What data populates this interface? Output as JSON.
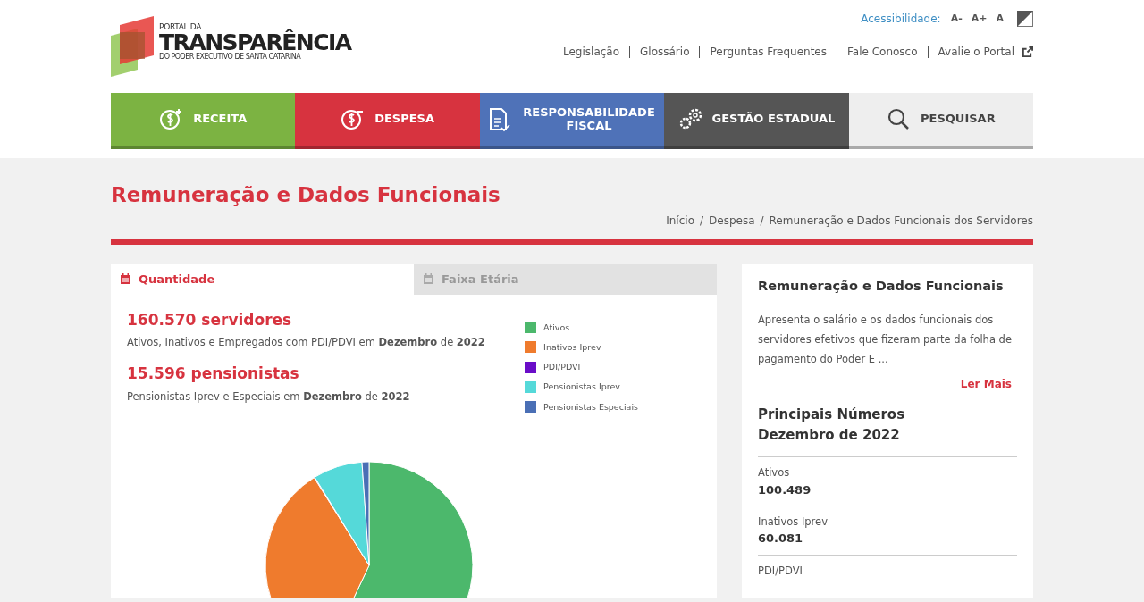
{
  "logo": {
    "line_1": "PORTAL DA",
    "line_2": "TRANSPARÊNCIA",
    "line_3": "DO PODER EXECUTIVO DE SANTA CATARINA"
  },
  "accessibility": {
    "label": "Acessibilidade:",
    "options": [
      "A-",
      "A+",
      "A"
    ]
  },
  "top_links": [
    {
      "label": "Legislação",
      "external": false
    },
    {
      "label": "Glossário",
      "external": false
    },
    {
      "label": "Perguntas Frequentes",
      "external": false
    },
    {
      "label": "Fale Conosco",
      "external": false
    },
    {
      "label": "Avalie o Portal",
      "external": true
    }
  ],
  "main_nav": [
    {
      "label": "RECEITA",
      "kind": "receita",
      "color": "#7cb342"
    },
    {
      "label": "DESPESA",
      "kind": "despesa",
      "color": "#d7333f"
    },
    {
      "label": "RESPONSABILIDADE FISCAL",
      "kind": "fiscal",
      "color": "#4f72b8"
    },
    {
      "label": "GESTÃO ESTADUAL",
      "kind": "gestao",
      "color": "#555555"
    },
    {
      "label": "PESQUISAR",
      "kind": "search",
      "color": "#eeeeee"
    }
  ],
  "page_title": "Remuneração e Dados Funcionais",
  "breadcrumb": {
    "separator": "/",
    "items": [
      "Início",
      "Despesa",
      "Remuneração e Dados Funcionais dos Servidores"
    ]
  },
  "tabs": [
    {
      "label": "Quantidade",
      "selected": true
    },
    {
      "label": "Faixa Etária",
      "selected": false
    }
  ],
  "stats": [
    {
      "headline": "160.570 servidores",
      "description": "Ativos, Inativos e Empregados com PDI/PDVI em **Dezembro** de **2022**"
    },
    {
      "headline": "15.596 pensionistas",
      "description": "Pensionistas Iprev e Especiais em **Dezembro** de **2022**"
    }
  ],
  "legend": [
    {
      "label": "Ativos",
      "color": "#4cb86c"
    },
    {
      "label": "Inativos Iprev",
      "color": "#ef7b2d"
    },
    {
      "label": "PDI/PDVI",
      "color": "#6a0dc8"
    },
    {
      "label": "Pensionistas Iprev",
      "color": "#55d9d9"
    },
    {
      "label": "Pensionistas Especiais",
      "color": "#4a6fb5"
    }
  ],
  "sidebar": {
    "title": "Remuneração e Dados Funcionais",
    "text": "Apresenta o salário e os dados funcionais dos servidores efetivos que fizeram parte da folha de pagamento do Poder E ...",
    "more_link": "Ler Mais",
    "numbers_title": "Principais Números",
    "numbers_period": "Dezembro de 2022",
    "numbers": [
      {
        "label": "Ativos",
        "value": "100.489"
      },
      {
        "label": "Inativos Iprev",
        "value": "60.081"
      },
      {
        "label": "PDI/PDVI"
      }
    ]
  }
}
